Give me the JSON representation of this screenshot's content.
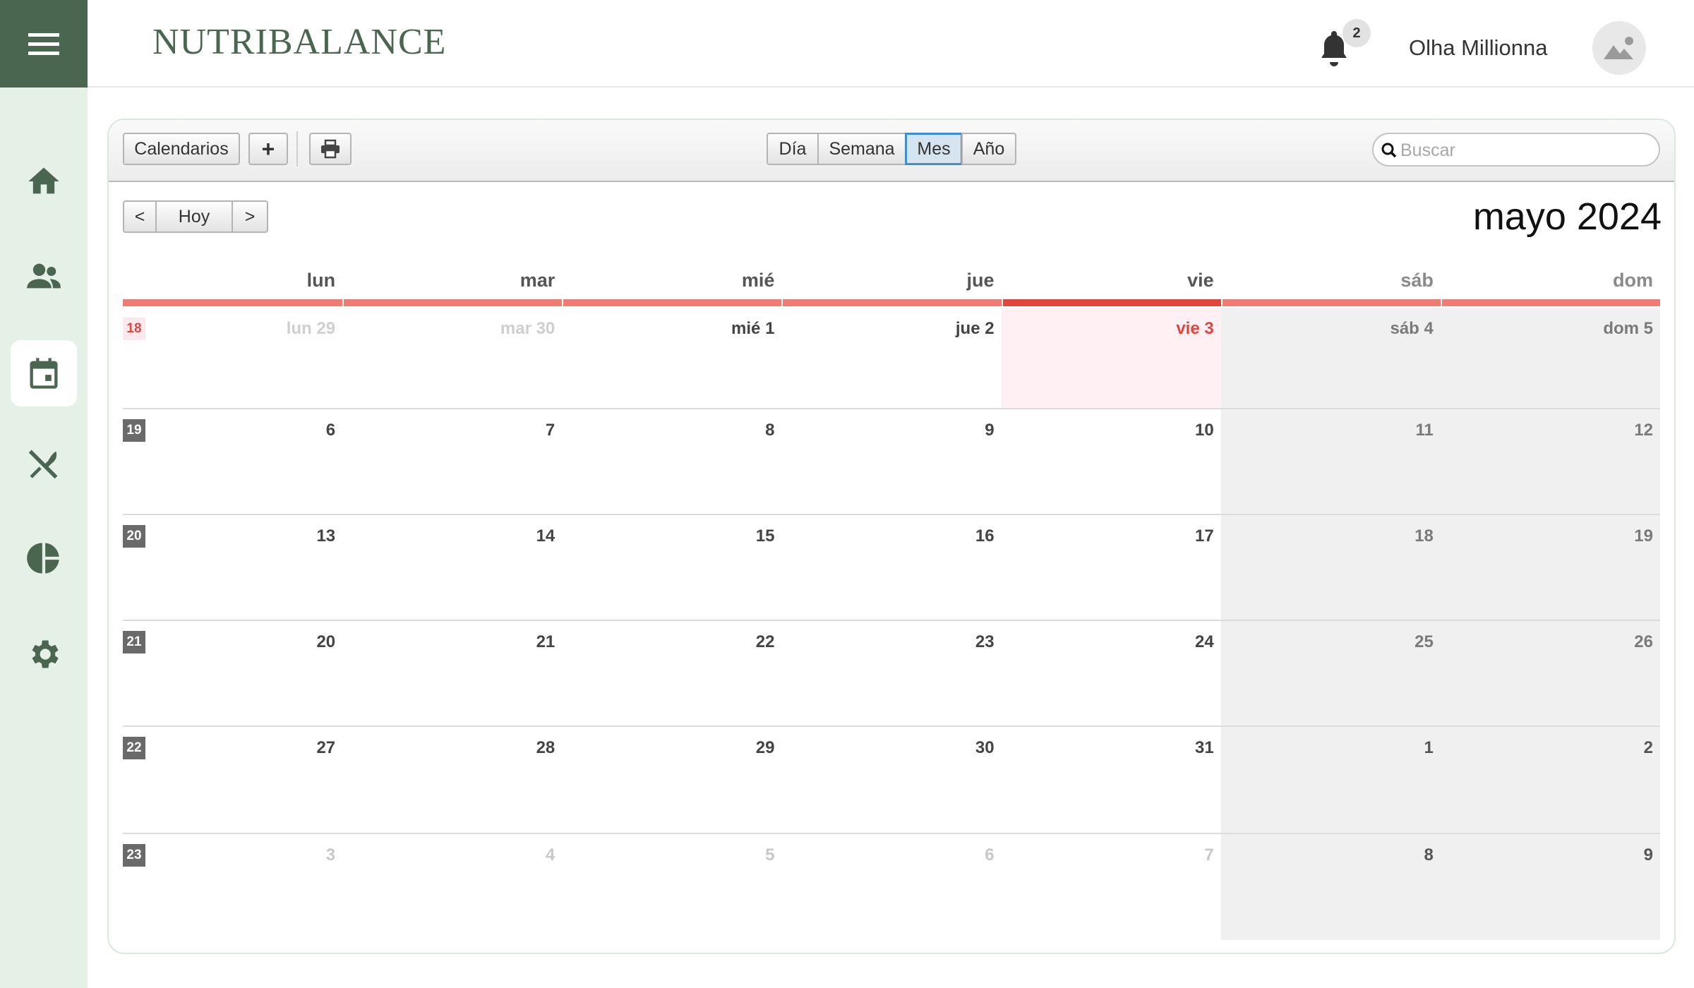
{
  "app": {
    "brand": "NUTRIBALANCE"
  },
  "header": {
    "notification_count": "2",
    "user_name": "Olha Millionna"
  },
  "sidebar": {
    "items": [
      {
        "name": "home",
        "icon": "home-icon",
        "active": false
      },
      {
        "name": "users",
        "icon": "users-icon",
        "active": false
      },
      {
        "name": "calendar",
        "icon": "calendar-icon",
        "active": true
      },
      {
        "name": "meals",
        "icon": "utensils-icon",
        "active": false
      },
      {
        "name": "stats",
        "icon": "pie-chart-icon",
        "active": false
      },
      {
        "name": "settings",
        "icon": "gear-icon",
        "active": false
      }
    ]
  },
  "toolbar": {
    "calendars_label": "Calendarios",
    "add_label": "+",
    "views": [
      "Día",
      "Semana",
      "Mes",
      "Año"
    ],
    "active_view": "Mes",
    "search_placeholder": "Buscar"
  },
  "nav": {
    "prev": "<",
    "today": "Hoy",
    "next": ">"
  },
  "calendar": {
    "title": "mayo 2024",
    "weekdays": [
      "lun",
      "mar",
      "mié",
      "jue",
      "vie",
      "sáb",
      "dom"
    ],
    "weeks": [
      {
        "week": "18",
        "days": [
          "lun 29",
          "mar 30",
          "mié 1",
          "jue 2",
          "vie 3",
          "sáb 4",
          "dom 5"
        ]
      },
      {
        "week": "19",
        "days": [
          "6",
          "7",
          "8",
          "9",
          "10",
          "11",
          "12"
        ]
      },
      {
        "week": "20",
        "days": [
          "13",
          "14",
          "15",
          "16",
          "17",
          "18",
          "19"
        ]
      },
      {
        "week": "21",
        "days": [
          "20",
          "21",
          "22",
          "23",
          "24",
          "25",
          "26"
        ]
      },
      {
        "week": "22",
        "days": [
          "27",
          "28",
          "29",
          "30",
          "31",
          "1",
          "2"
        ]
      },
      {
        "week": "23",
        "days": [
          "3",
          "4",
          "5",
          "6",
          "7",
          "8",
          "9"
        ]
      }
    ],
    "today": "vie 3",
    "colors": {
      "accent": "#4b6650",
      "today": "#e0463e",
      "line": "#ef7b72"
    }
  }
}
